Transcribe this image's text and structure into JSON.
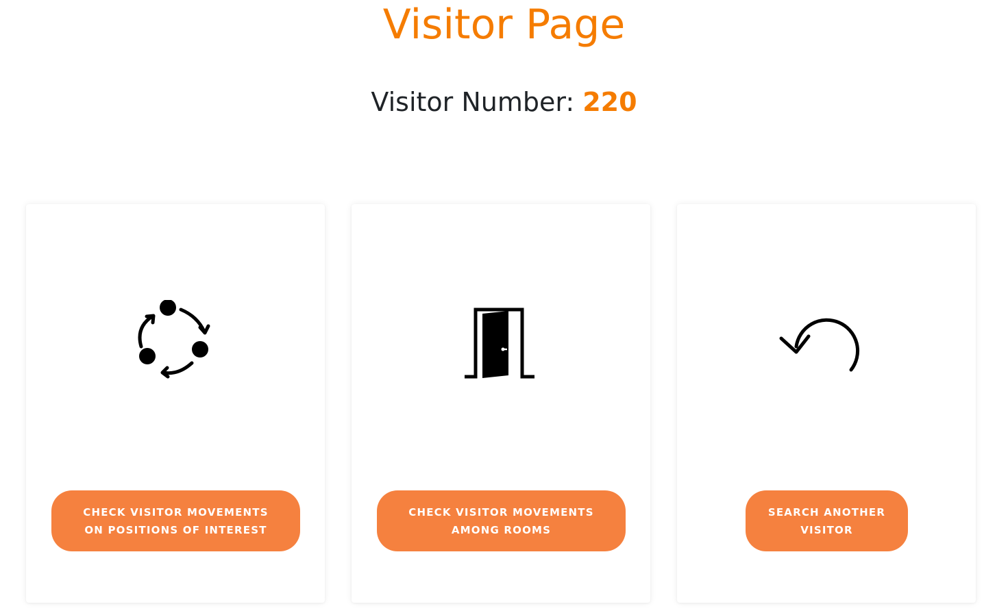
{
  "header": {
    "title": "Visitor Page",
    "visitor_label": "Visitor Number:",
    "visitor_number": "220"
  },
  "colors": {
    "accent": "#f57c00",
    "button": "#f5813f",
    "text": "#1f2327"
  },
  "cards": [
    {
      "icon": "cycle-arrows-icon",
      "button_line1": "CHECK VISITOR MOVEMENTS",
      "button_line2": "ON POSITIONS OF INTEREST"
    },
    {
      "icon": "open-door-icon",
      "button_line1": "CHECK VISITOR MOVEMENTS",
      "button_line2": "AMONG ROOMS"
    },
    {
      "icon": "undo-arrow-icon",
      "button_line1": "SEARCH ANOTHER",
      "button_line2": "VISITOR"
    }
  ]
}
